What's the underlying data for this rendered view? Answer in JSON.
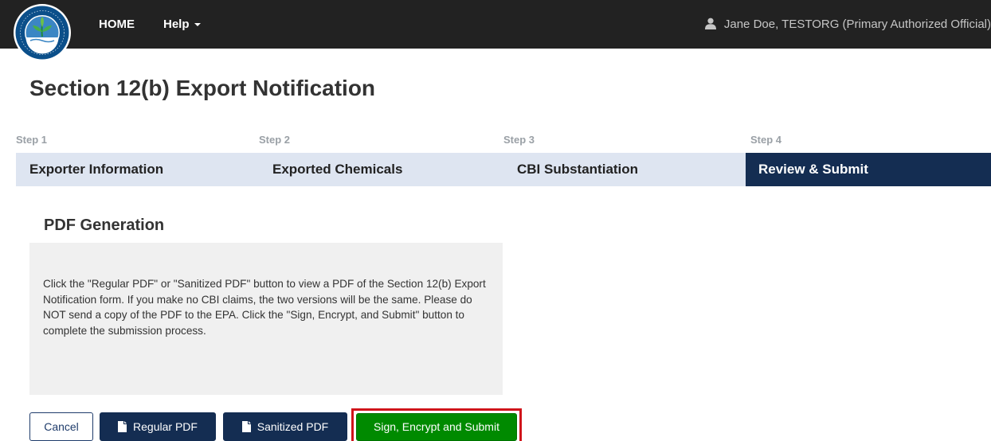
{
  "nav": {
    "home_label": "HOME",
    "help_label": "Help",
    "user_label": "Jane Doe, TESTORG (Primary Authorized Official)"
  },
  "icons": {
    "logo": "epa-seal-logo",
    "user": "user-icon",
    "caret": "caret-down-icon",
    "file": "file-icon"
  },
  "page": {
    "title": "Section 12(b) Export Notification"
  },
  "steps": [
    {
      "step": "Step 1",
      "title": "Exporter Information",
      "active": false
    },
    {
      "step": "Step 2",
      "title": "Exported Chemicals",
      "active": false
    },
    {
      "step": "Step 3",
      "title": "CBI Substantiation",
      "active": false
    },
    {
      "step": "Step 4",
      "title": "Review & Submit",
      "active": true
    }
  ],
  "pdf": {
    "heading": "PDF Generation",
    "instructions": "Click the \"Regular PDF\" or \"Sanitized PDF\" button to view a PDF of the Section 12(b) Export Notification form. If you make no CBI claims, the two versions will be the same. Please do NOT send a copy of the PDF to the EPA. Click the \"Sign, Encrypt, and Submit\" button to complete the submission process."
  },
  "buttons": {
    "cancel": "Cancel",
    "regular_pdf": "Regular PDF",
    "sanitized_pdf": "Sanitized PDF",
    "submit": "Sign, Encrypt and Submit"
  },
  "colors": {
    "navbar": "#222222",
    "step_bar": "#dee5f1",
    "step_active": "#142d52",
    "primary_button": "#142d52",
    "submit_button": "#008a00",
    "highlight_border": "#d0141b"
  }
}
